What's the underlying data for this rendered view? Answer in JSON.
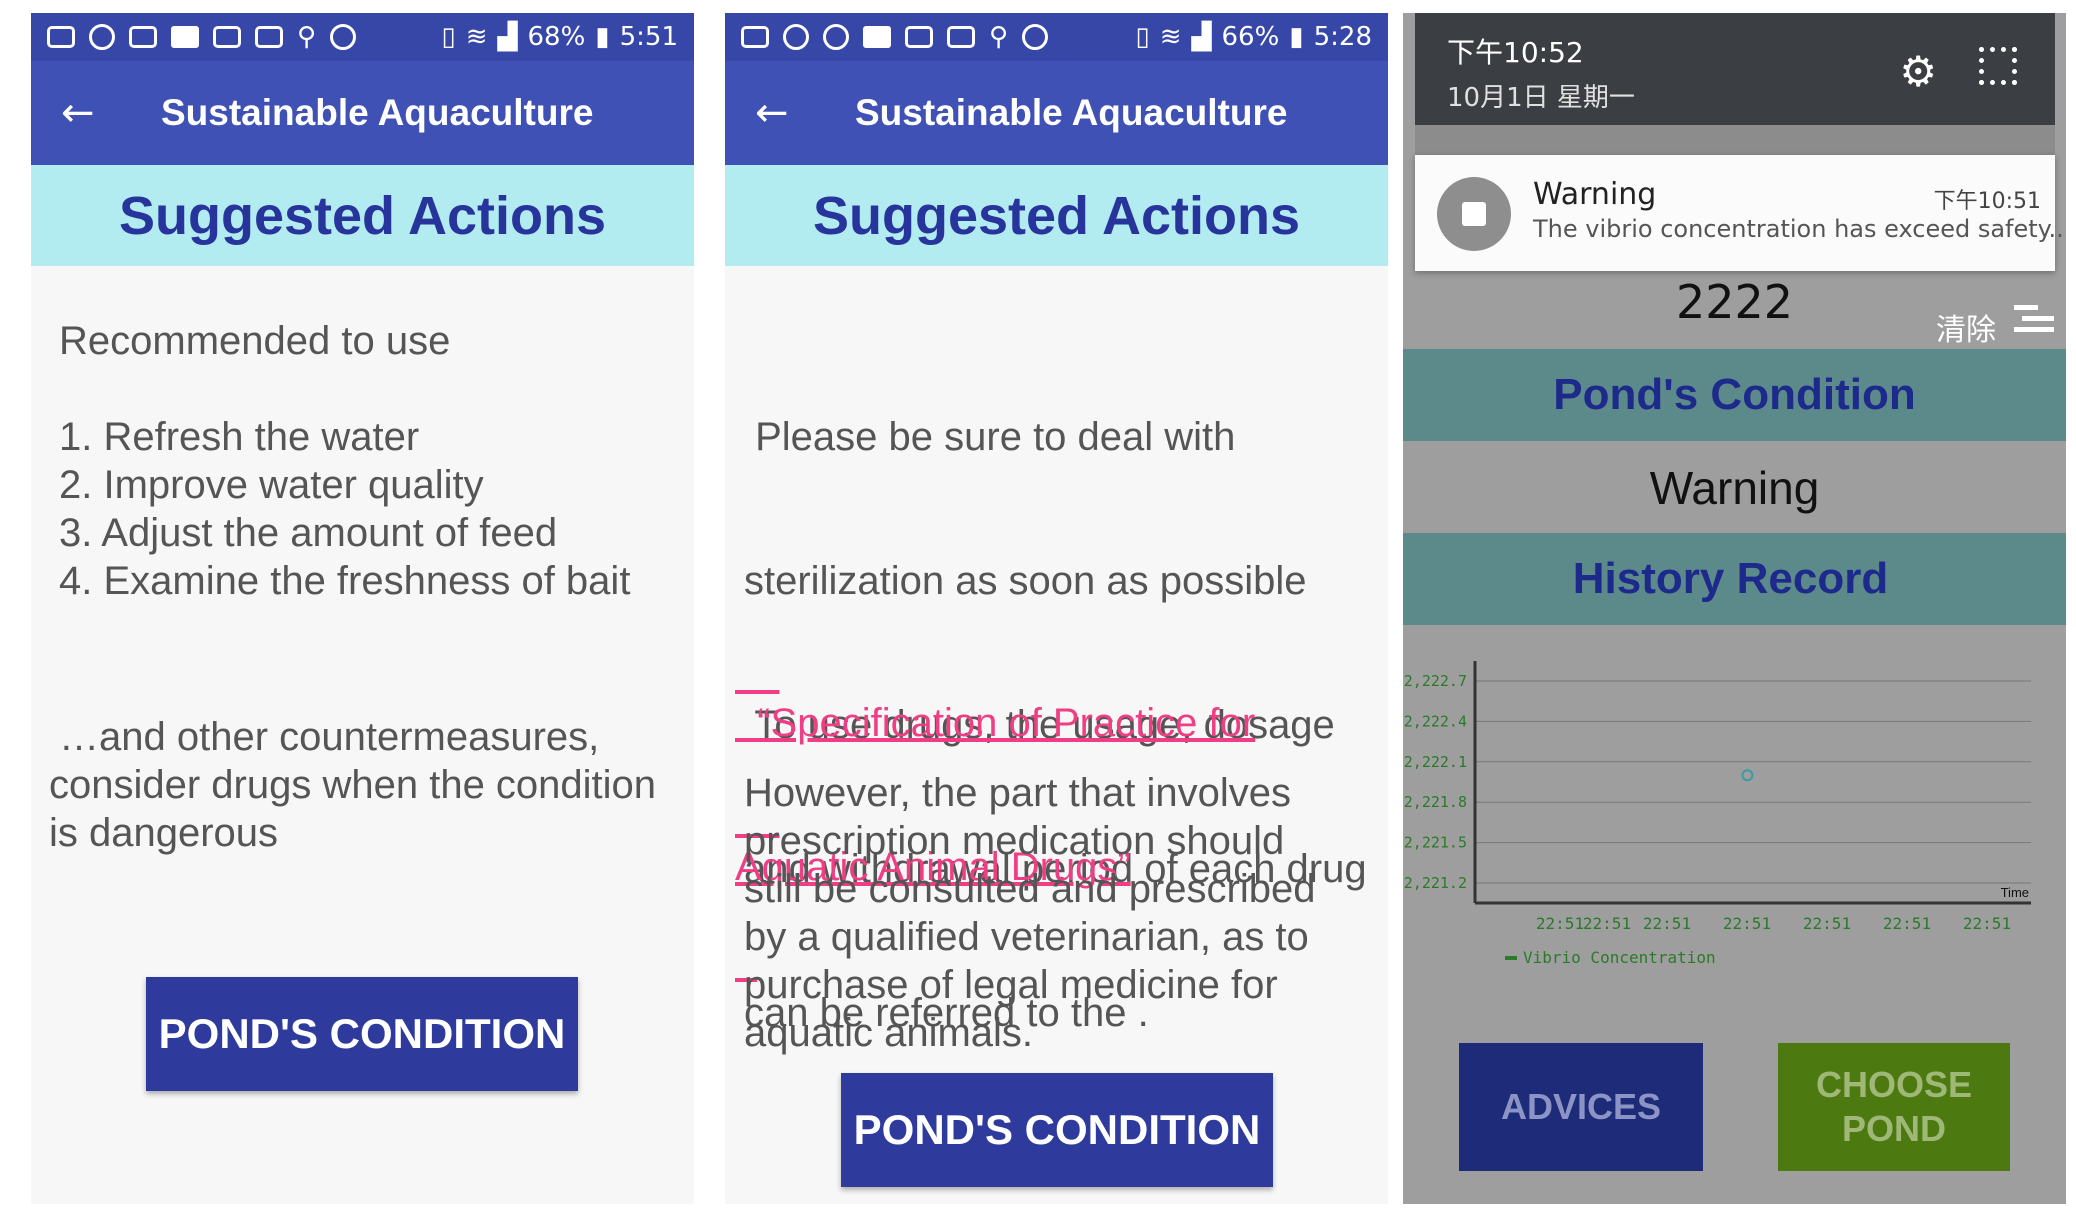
{
  "screen1": {
    "status": {
      "battery": "68%",
      "time": "5:51"
    },
    "appbar": {
      "back": "←",
      "title": "Sustainable Aquaculture"
    },
    "banner": "Suggested Actions",
    "intro": "Recommended to use",
    "items": [
      "1. Refresh the water",
      "2. Improve water quality",
      "3. Adjust the amount of feed",
      "4. Examine the freshness of bait"
    ],
    "outro": [
      "…and other countermeasures,",
      "consider drugs when the condition",
      "is dangerous"
    ],
    "button": "POND'S CONDITION"
  },
  "screen2": {
    "status": {
      "battery": "66%",
      "time": "5:28"
    },
    "appbar": {
      "back": "←",
      "title": "Sustainable Aquaculture"
    },
    "banner": "Suggested Actions",
    "para1": [
      " Please be sure to deal with",
      "sterilization as soon as possible",
      " To use drugs, the usage, dosage",
      "and withdrawal period of each drug",
      "can be referred to the ."
    ],
    "link": [
      "  “Specification of Practice for",
      "Aquatic Animal Drugs”"
    ],
    "para2": [
      "However, the part that involves",
      "prescription medication should",
      "still be consulted and prescribed",
      "by a qualified veterinarian, as to",
      "purchase of legal medicine for",
      "aquatic animals."
    ],
    "button": "POND'S CONDITION"
  },
  "screen3": {
    "shade": {
      "time": "下午10:52",
      "date": "10月1日 星期一",
      "gear": "⚙"
    },
    "notification": {
      "title": "Warning",
      "time": "下午10:51",
      "message": "The vibrio concentration has exceed safety.."
    },
    "value": "2222",
    "clear": "清除",
    "condition_header": "Pond's Condition",
    "condition": "Warning",
    "history_header": "History Record",
    "buttons": {
      "advices": "ADVICES",
      "choose_pond": [
        "CHOOSE",
        "POND"
      ]
    },
    "colors": {
      "advices_bg": "#1e2b78",
      "advices_fg": "#8c94c6",
      "choose_bg": "#4c7a10",
      "choose_fg": "#9fb878"
    }
  },
  "chart_data": {
    "type": "scatter",
    "x": [
      "22:51",
      "22:51",
      "22:51",
      "22:51",
      "22:51",
      "22:51",
      "22:51"
    ],
    "x_tick_labels": [
      "22:51",
      "22:51",
      "22:51",
      "22:51",
      "22:51",
      "22:51",
      "22:51"
    ],
    "y_tick_labels": [
      "2,222.7",
      "2,222.4",
      "2,222.1",
      "2,221.8",
      "2,221.5",
      "2,221.2"
    ],
    "ylim": [
      2221.2,
      2222.7
    ],
    "xlabel": "Time",
    "ylabel": "",
    "series": [
      {
        "name": "Vibrio Concentration",
        "points": [
          {
            "x": "22:51",
            "y": 2222.0
          }
        ]
      }
    ],
    "point_x_fraction": 0.49,
    "grid": true,
    "legend": "bottom-left",
    "colors": {
      "series": "#3a9aa8",
      "legend": "#2a7a2a",
      "tick": "#2a7a2a"
    }
  }
}
